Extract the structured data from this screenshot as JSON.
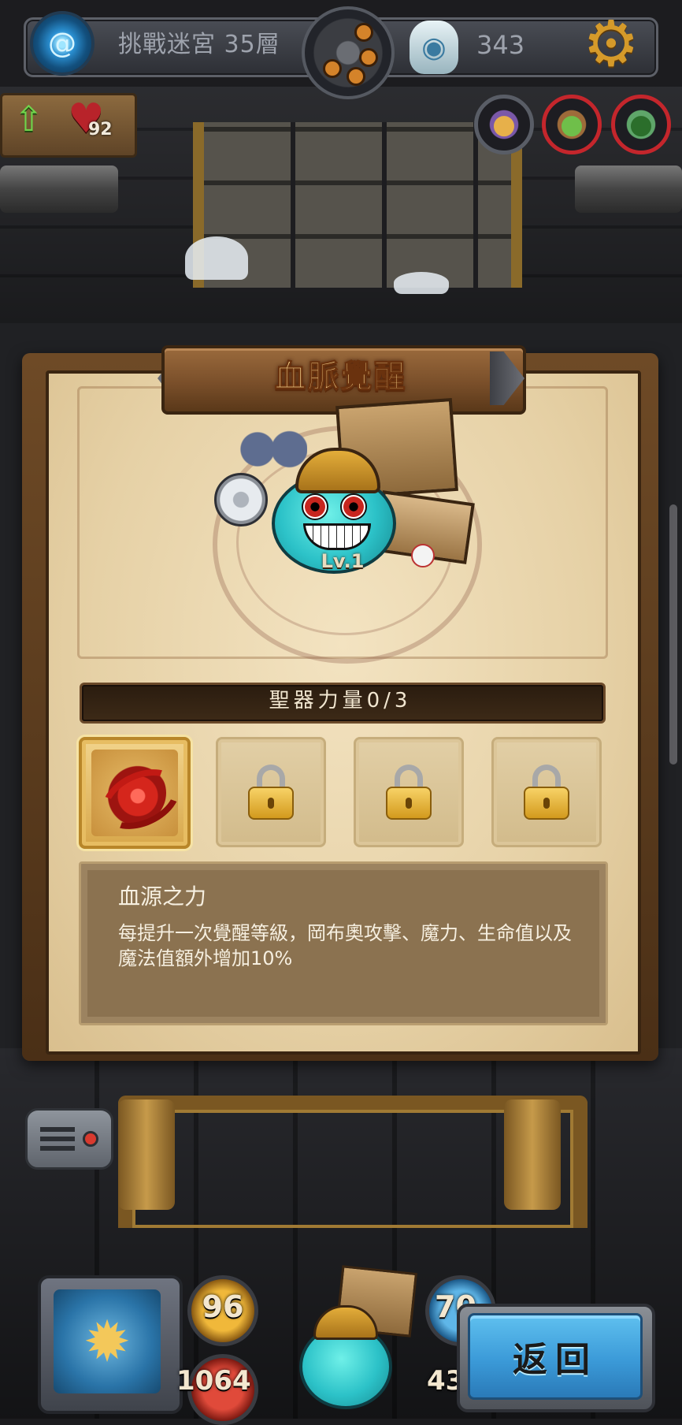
{
  "top_bar": {
    "floor_label": "挑戰迷宮 35層",
    "currency_count": "343"
  },
  "level_sign": {
    "heart_count": "92"
  },
  "panel": {
    "title": "血脈覺醒",
    "hero_level": "Lv.1",
    "power_bar_label": "聖器力量0/3",
    "slots": [
      {
        "state": "unlocked",
        "icon": "blood-swirl-icon"
      },
      {
        "state": "locked",
        "icon": "lock-icon"
      },
      {
        "state": "locked",
        "icon": "lock-icon"
      },
      {
        "state": "locked",
        "icon": "lock-icon"
      }
    ],
    "description": {
      "title": "血源之力",
      "text": "每提升一次覺醒等級，岡布奧攻擊、魔力、生命值以及魔法值額外增加10%"
    }
  },
  "hud": {
    "attack_value": "96",
    "hp_value": "1064",
    "mp_value_top": "70",
    "mp_value_bottom": "43",
    "back_button_label": "返回"
  }
}
